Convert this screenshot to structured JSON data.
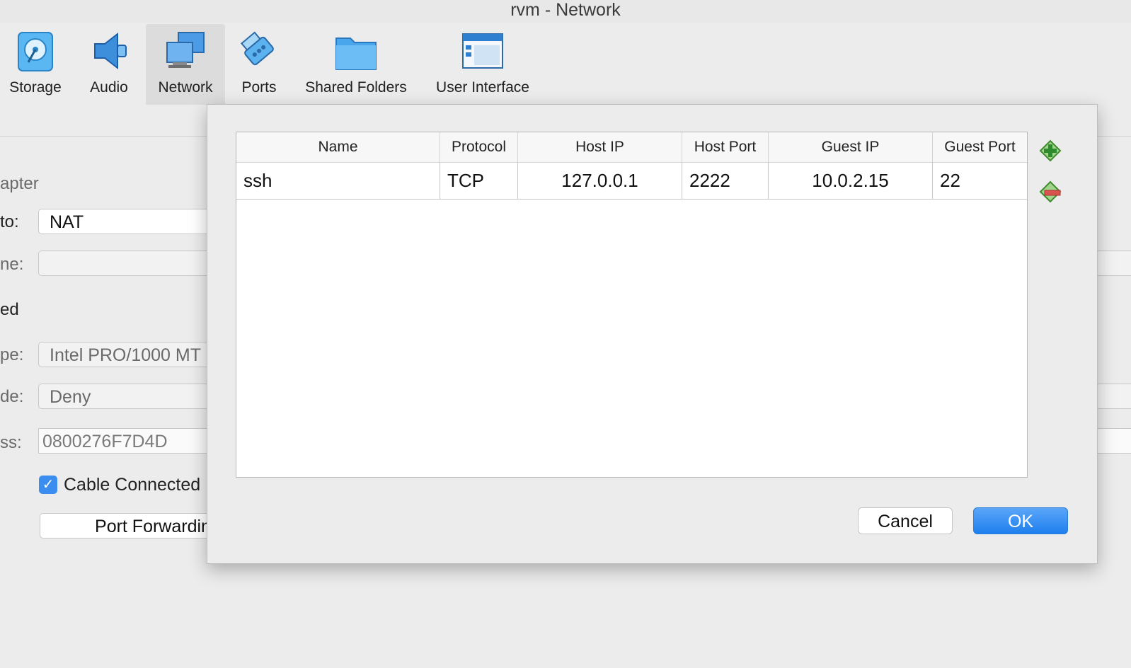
{
  "window": {
    "title": "rvm - Network"
  },
  "toolbar": {
    "items": [
      {
        "label": "Storage",
        "icon": "storage-icon"
      },
      {
        "label": "Audio",
        "icon": "audio-icon"
      },
      {
        "label": "Network",
        "icon": "network-icon",
        "active": true
      },
      {
        "label": "Ports",
        "icon": "ports-icon"
      },
      {
        "label": "Shared Folders",
        "icon": "shared-folders-icon"
      },
      {
        "label": "User Interface",
        "icon": "user-interface-icon"
      }
    ]
  },
  "background": {
    "adapter_heading": "apter",
    "attached_label": "to:",
    "attached_value": "NAT",
    "name_label": "ne:",
    "name_value": "",
    "advanced_label": "ed",
    "adapter_type_label": "pe:",
    "adapter_type_value": "Intel PRO/1000 MT",
    "promisc_label": "de:",
    "promisc_value": "Deny",
    "mac_label": "ss:",
    "mac_value": "0800276F7D4D",
    "cable_connected_label": "Cable Connected",
    "cable_connected_checked": true,
    "port_forwarding_button": "Port Forwardin"
  },
  "dialog": {
    "columns": [
      "Name",
      "Protocol",
      "Host IP",
      "Host Port",
      "Guest IP",
      "Guest Port"
    ],
    "rules": [
      {
        "name": "ssh",
        "protocol": "TCP",
        "host_ip": "127.0.0.1",
        "host_port": "2222",
        "guest_ip": "10.0.2.15",
        "guest_port": "22"
      }
    ],
    "add_rule_icon": "add-rule-icon",
    "remove_rule_icon": "remove-rule-icon",
    "cancel_label": "Cancel",
    "ok_label": "OK",
    "accent_color": "#1f7fee"
  }
}
